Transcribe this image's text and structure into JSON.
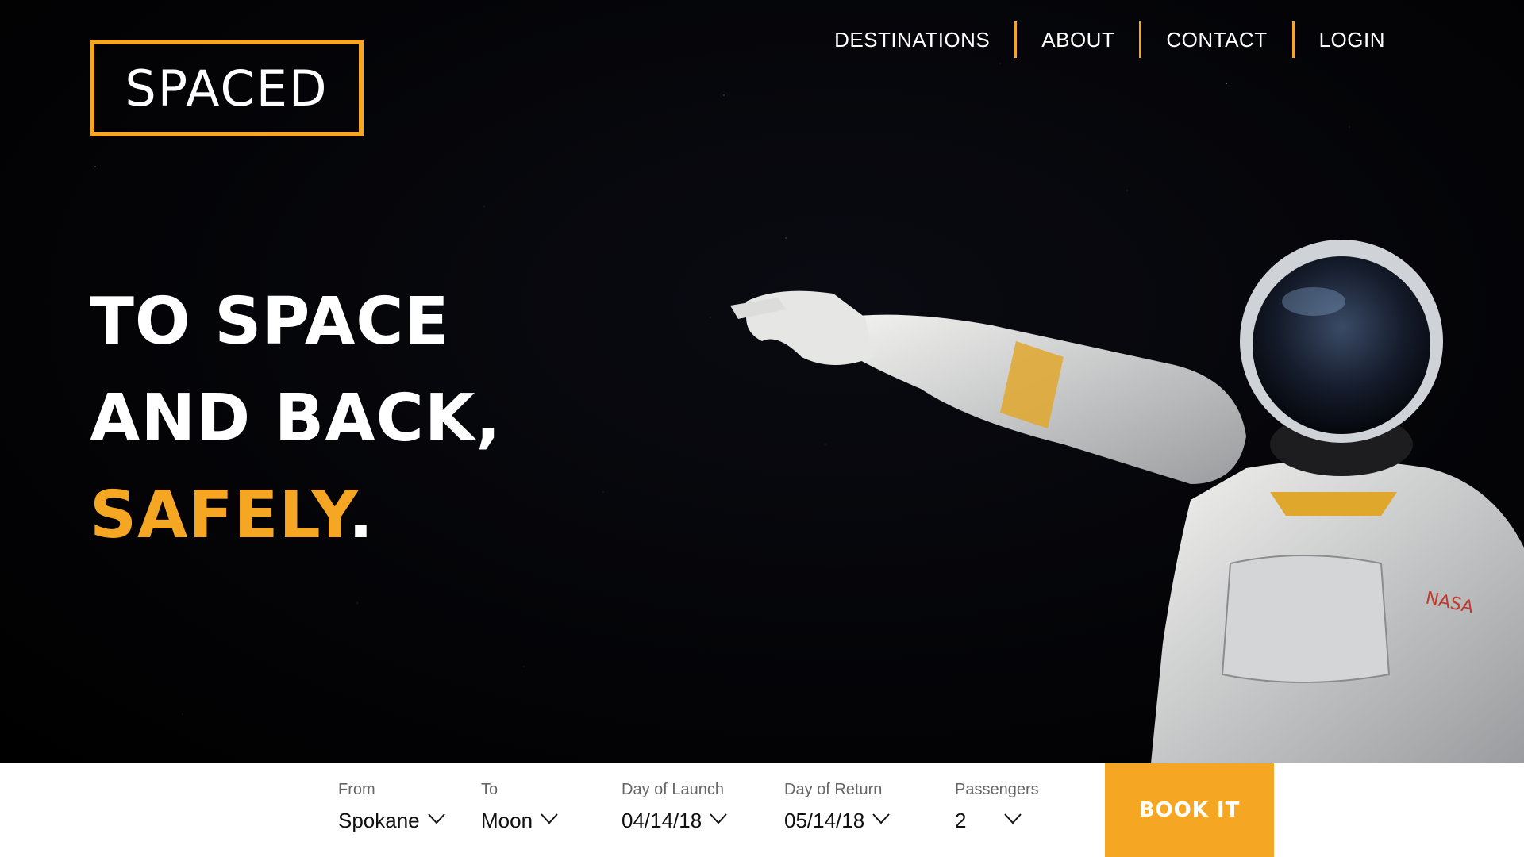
{
  "brand": {
    "logo_text": "SPACED",
    "accent_color": "#f5a623"
  },
  "nav": {
    "items": [
      {
        "label": "DESTINATIONS"
      },
      {
        "label": "ABOUT"
      },
      {
        "label": "CONTACT"
      },
      {
        "label": "LOGIN"
      }
    ]
  },
  "hero": {
    "line1": "TO SPACE",
    "line2": "AND BACK,",
    "line3_accent": "SAFELY",
    "line3_end": "."
  },
  "booking": {
    "from": {
      "label": "From",
      "value": "Spokane"
    },
    "to": {
      "label": "To",
      "value": "Moon"
    },
    "launch": {
      "label": "Day of Launch",
      "value": "04/14/18"
    },
    "return": {
      "label": "Day of Return",
      "value": "05/14/18"
    },
    "passengers": {
      "label": "Passengers",
      "value": "2"
    },
    "cta_label": "BOOK IT"
  },
  "icons": {
    "dropdown": "chevron-down-icon"
  }
}
